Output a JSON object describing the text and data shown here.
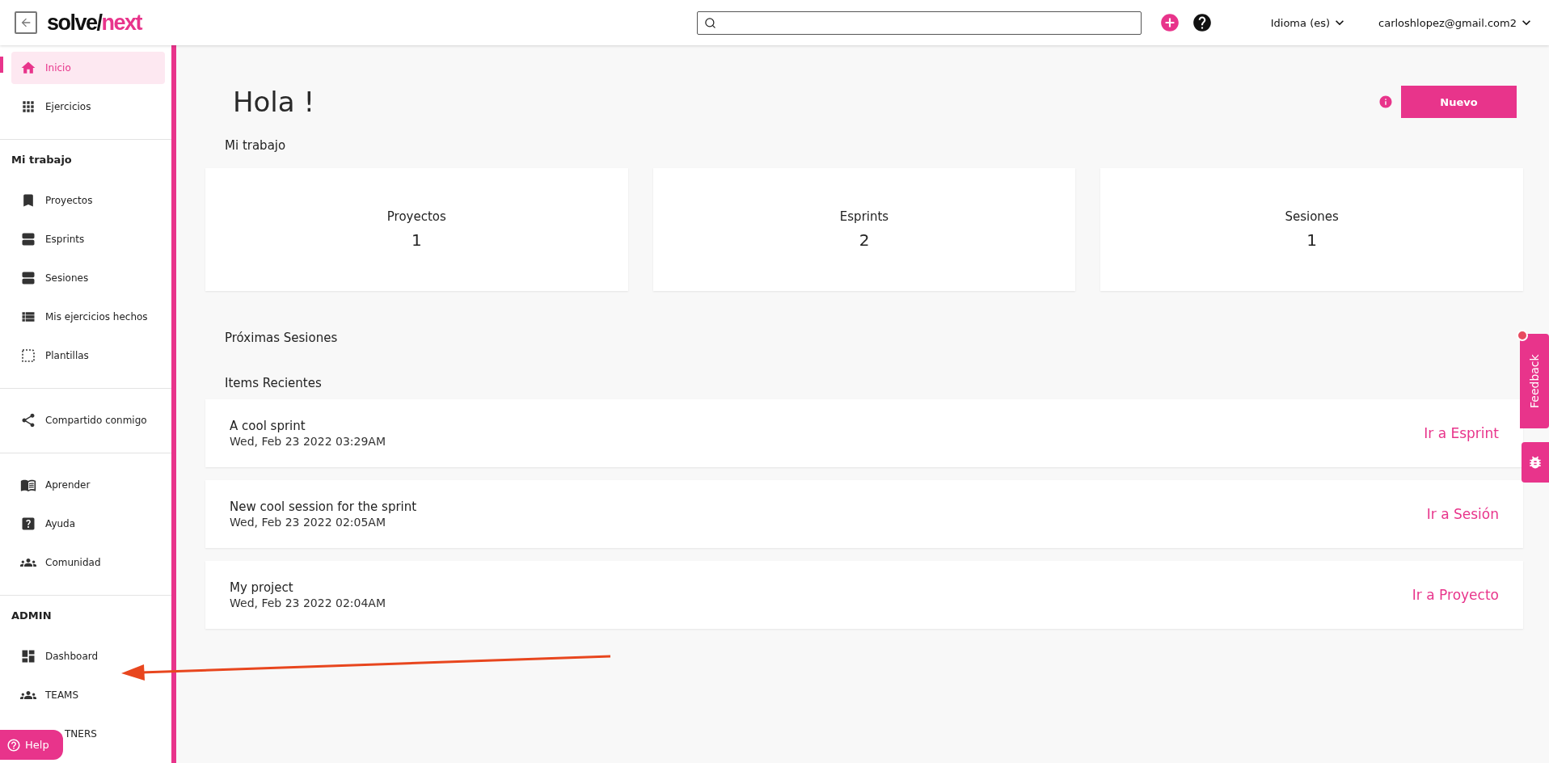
{
  "topbar": {
    "logo": {
      "text": "solve/",
      "accent": "next"
    },
    "language": "Idioma (es)",
    "user": "carloshlopez@gmail.com2"
  },
  "sidebar": {
    "sections": [
      {
        "items": [
          {
            "label": "Inicio",
            "selected": true
          },
          {
            "label": "Ejercicios",
            "selected": false
          }
        ]
      },
      {
        "title": "Mi trabajo",
        "items": [
          {
            "label": "Proyectos",
            "selected": false
          },
          {
            "label": "Esprints",
            "selected": false
          },
          {
            "label": "Sesiones",
            "selected": false
          },
          {
            "label": "Mis ejercicios hechos",
            "selected": false
          },
          {
            "label": "Plantillas",
            "selected": false
          }
        ]
      },
      {
        "items": [
          {
            "label": "Compartido conmigo",
            "selected": false
          }
        ]
      },
      {
        "items": [
          {
            "label": "Aprender",
            "selected": false
          },
          {
            "label": "Ayuda",
            "selected": false
          },
          {
            "label": "Comunidad",
            "selected": false
          }
        ]
      },
      {
        "title": "ADMIN",
        "items": [
          {
            "label": "Dashboard",
            "selected": false
          },
          {
            "label": "TEAMS",
            "selected": false
          },
          {
            "label": "TNERS",
            "selected": false
          }
        ]
      }
    ],
    "help_button": "Help"
  },
  "main": {
    "greeting": "Hola !",
    "new_button": "Nuevo",
    "my_work_title": "Mi trabajo",
    "stats": [
      {
        "label": "Proyectos",
        "value": "1"
      },
      {
        "label": "Esprints",
        "value": "2"
      },
      {
        "label": "Sesiones",
        "value": "1"
      }
    ],
    "upcoming_title": "Próximas Sesiones",
    "recent_title": "Items Recientes",
    "recent_items": [
      {
        "title": "A cool sprint",
        "date": "Wed, Feb 23 2022 03:29AM",
        "link": "Ir a Esprint"
      },
      {
        "title": "New cool session for the sprint",
        "date": "Wed, Feb 23 2022 02:05AM",
        "link": "Ir a Sesión"
      },
      {
        "title": "My project",
        "date": "Wed, Feb 23 2022 02:04AM",
        "link": "Ir a Proyecto"
      }
    ]
  },
  "feedback_tab": "Feedback"
}
